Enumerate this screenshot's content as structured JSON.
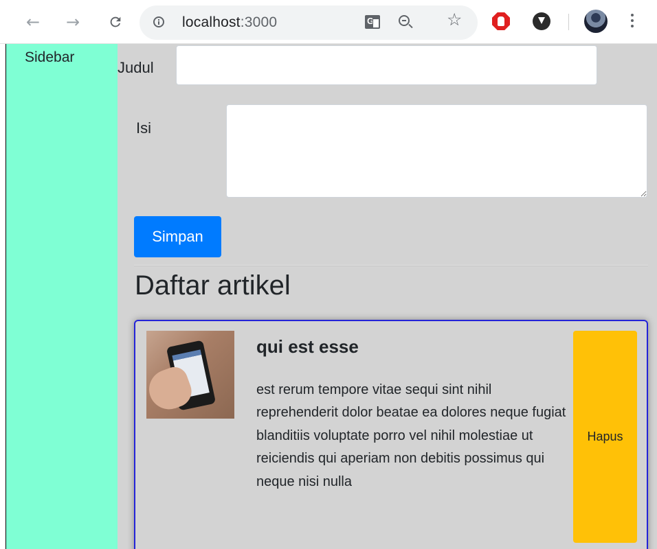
{
  "browser": {
    "nav_back_glyph": "←",
    "nav_forward_glyph": "→",
    "reload_glyph": "C",
    "url_host": "localhost",
    "url_port": ":3000",
    "icons": [
      "back-arrow-icon",
      "forward-arrow-icon",
      "reload-icon",
      "info-icon",
      "translate-icon",
      "zoom-out-icon",
      "star-icon",
      "adblock-extension-icon",
      "download-extension-icon",
      "profile-avatar",
      "more-menu-icon"
    ]
  },
  "sidebar": {
    "title": "Sidebar",
    "background": "#7fffd4"
  },
  "form": {
    "title_label": "Judul",
    "title_value": "",
    "content_label": "Isi",
    "content_value": "",
    "submit_label": "Simpan",
    "submit_color": "#007bff"
  },
  "list": {
    "heading": "Daftar artikel",
    "articles": [
      {
        "title": "qui est esse",
        "body": "est rerum tempore vitae sequi sint nihil reprehenderit dolor beatae ea dolores neque fugiat blanditiis voluptate porro vel nihil molestiae ut reiciendis qui aperiam non debitis possimus qui neque nisi nulla",
        "delete_label": "Hapus",
        "delete_color": "#ffc107",
        "card_border_color": "#2323d8",
        "image_icon": "phone-photo"
      }
    ]
  },
  "colors": {
    "main_background": "#d3d3d3"
  }
}
